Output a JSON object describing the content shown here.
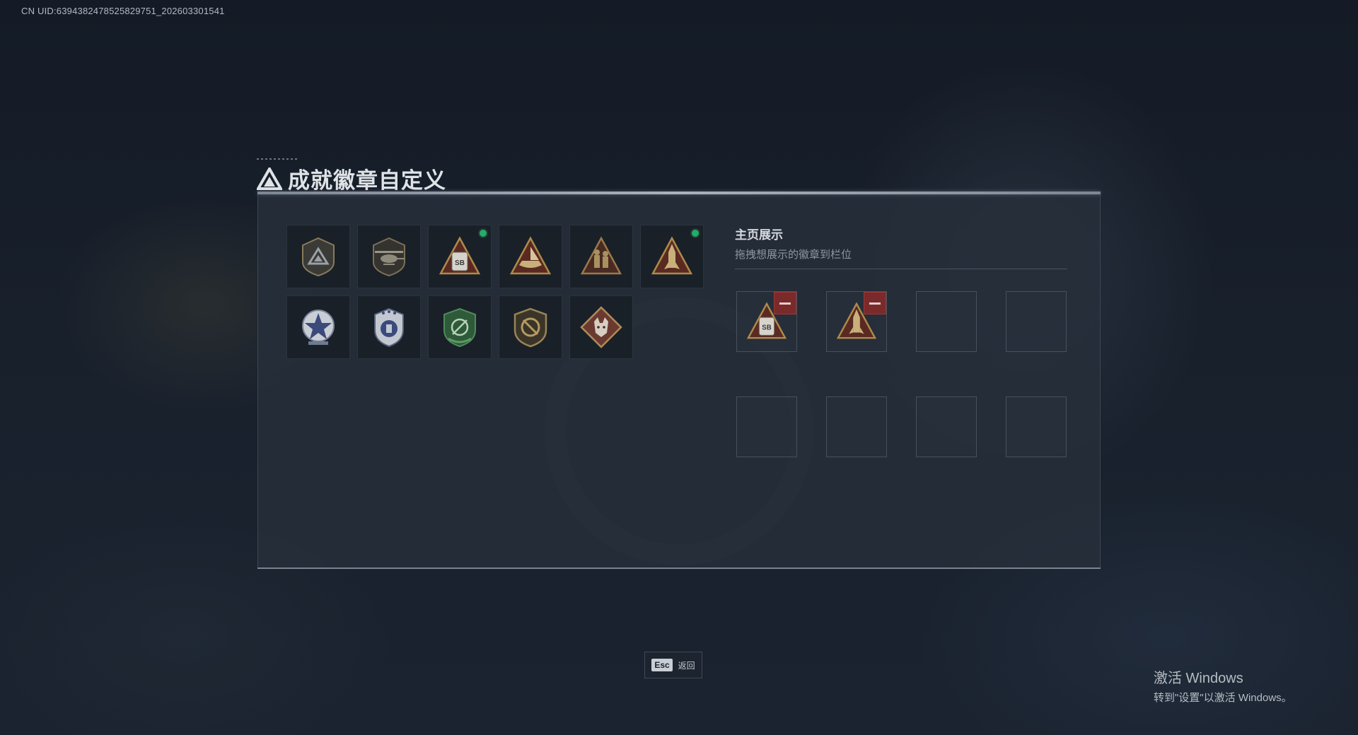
{
  "uid_text": "CN UID:6394382478525829751_202603301541",
  "title": "成就徽章自定义",
  "colors": {
    "accent_green": "#1fae6c",
    "remove_red": "#7a2a2a",
    "badge_gold": "#b08a4a"
  },
  "badges": [
    {
      "icon": "shield-triangle-badge-icon",
      "new": false
    },
    {
      "icon": "helicopter-badge-icon",
      "new": false
    },
    {
      "icon": "sb-pouch-triangle-badge-icon",
      "new": true
    },
    {
      "icon": "boat-triangle-badge-icon",
      "new": false
    },
    {
      "icon": "soldiers-triangle-badge-icon",
      "new": false
    },
    {
      "icon": "rocket-triangle-badge-icon",
      "new": true
    },
    {
      "icon": "star-wings-badge-icon",
      "new": false
    },
    {
      "icon": "police-shield-badge-icon",
      "new": false
    },
    {
      "icon": "green-crosshair-shield-badge-icon",
      "new": false
    },
    {
      "icon": "no-target-shield-badge-icon",
      "new": false
    },
    {
      "icon": "wolf-diamond-badge-icon",
      "new": false
    }
  ],
  "showcase": {
    "title": "主页展示",
    "subtitle": "拖拽想展示的徽章到栏位",
    "slots": [
      {
        "filled": true,
        "icon": "sb-pouch-triangle-badge-icon"
      },
      {
        "filled": true,
        "icon": "rocket-triangle-badge-icon"
      },
      {
        "filled": false
      },
      {
        "filled": false
      },
      {
        "filled": false
      },
      {
        "filled": false
      },
      {
        "filled": false
      },
      {
        "filled": false
      }
    ]
  },
  "footer": {
    "esc_key": "Esc",
    "esc_label": "返回"
  },
  "windows_activation": {
    "line1": "激活 Windows",
    "line2": "转到\"设置\"以激活 Windows。"
  }
}
